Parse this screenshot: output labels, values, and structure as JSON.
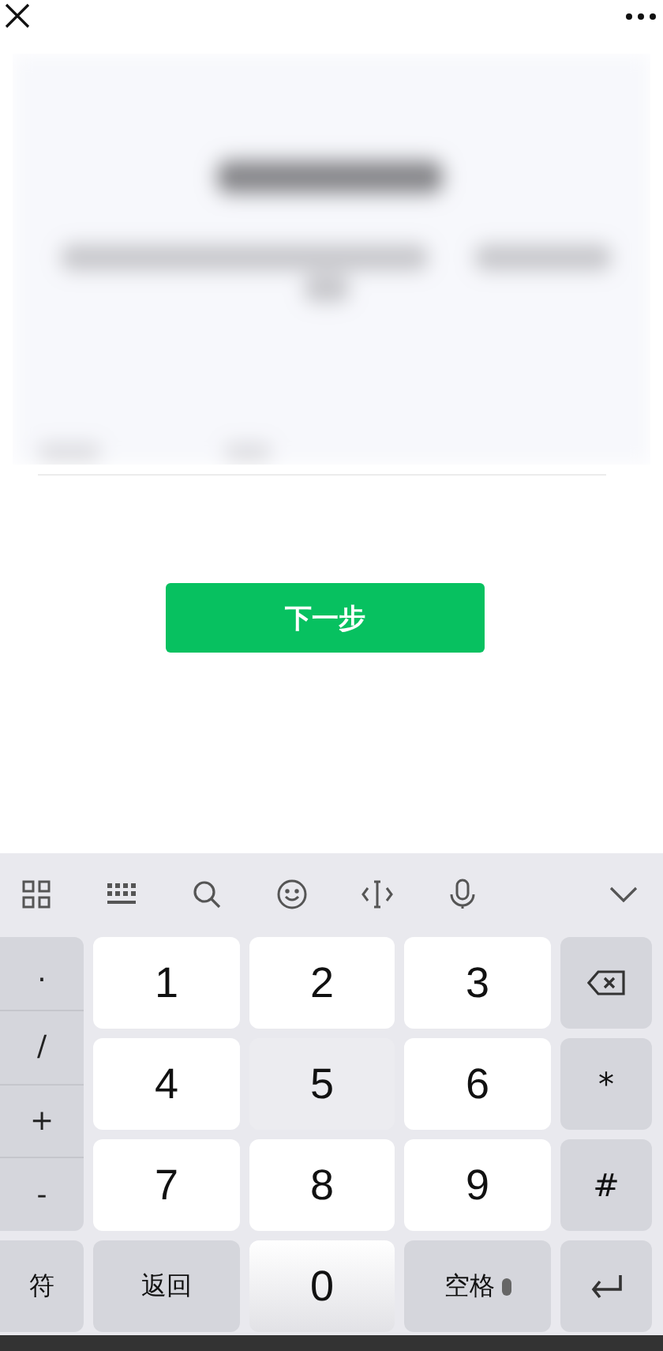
{
  "next_button": {
    "label": "下一步"
  },
  "keyboard": {
    "symbols": [
      ".",
      "/",
      "+",
      "-"
    ],
    "digits": [
      {
        "label": "1",
        "pressed": false
      },
      {
        "label": "2",
        "pressed": false
      },
      {
        "label": "3",
        "pressed": false
      },
      {
        "label": "4",
        "pressed": false
      },
      {
        "label": "5",
        "pressed": true
      },
      {
        "label": "6",
        "pressed": false
      },
      {
        "label": "7",
        "pressed": false
      },
      {
        "label": "8",
        "pressed": false
      },
      {
        "label": "9",
        "pressed": false
      }
    ],
    "side_keys": [
      {
        "kind": "backspace"
      },
      {
        "kind": "text",
        "label": "*"
      },
      {
        "kind": "text",
        "label": "#"
      }
    ],
    "bottom_row": [
      {
        "kind": "text",
        "label": "符"
      },
      {
        "kind": "text",
        "label": "返回"
      },
      {
        "kind": "digit",
        "label": "0"
      },
      {
        "kind": "space",
        "label": "空格"
      },
      {
        "kind": "enter"
      }
    ]
  }
}
